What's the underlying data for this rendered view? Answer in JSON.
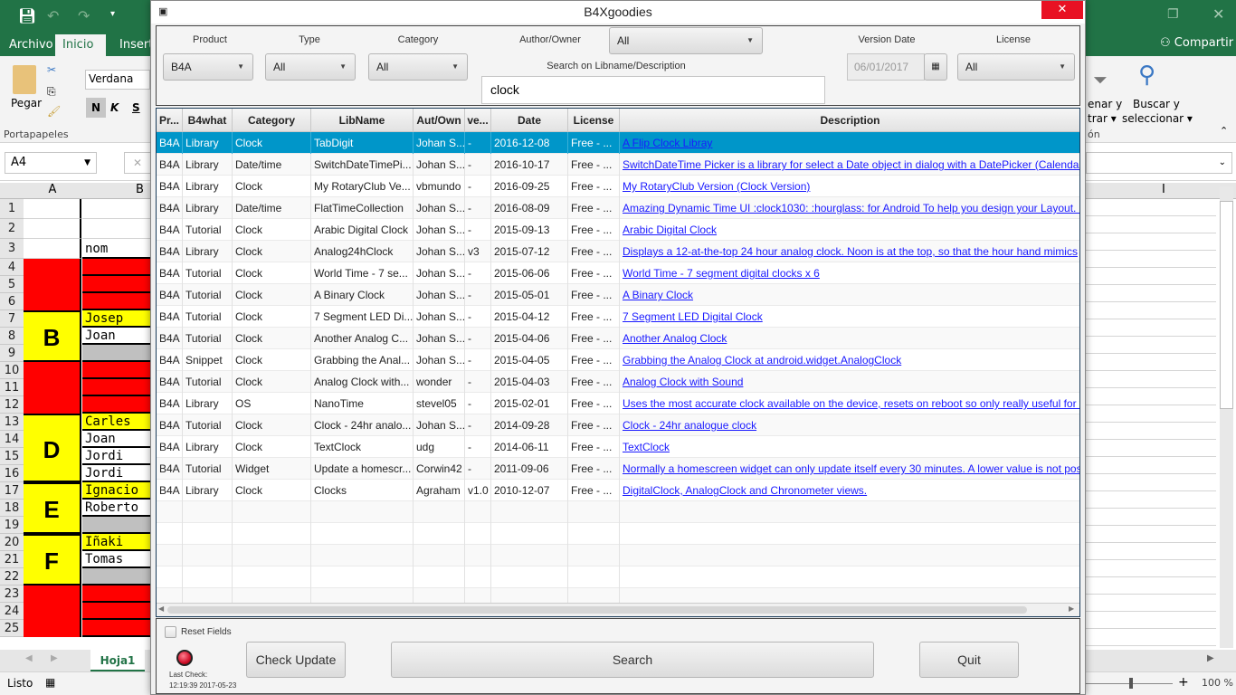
{
  "excel": {
    "tabs": [
      "Archivo",
      "Inicio",
      "Insertar"
    ],
    "share": "Compartir",
    "clipboard": {
      "paste": "Pegar",
      "group": "Portapapeles"
    },
    "font": "Verdana",
    "bold": "N",
    "italic": "K",
    "underline": "S",
    "find": "Buscar y",
    "find2": "seleccionar ▾",
    "sort": "enar y",
    "sort2": "trar ▾",
    "group_end": "ón",
    "namebox": "A4",
    "col_a": "A",
    "col_b": "B",
    "col_i": "I",
    "b3": "nom",
    "rows": [
      "1",
      "2",
      "3",
      "4",
      "5",
      "6",
      "7",
      "8",
      "9",
      "10",
      "11",
      "12",
      "13",
      "14",
      "15",
      "16",
      "17",
      "18",
      "19",
      "20",
      "21",
      "22",
      "23",
      "24",
      "25"
    ],
    "groups": [
      {
        "letter": "B"
      },
      {
        "letter": "D"
      },
      {
        "letter": "E"
      },
      {
        "letter": "F"
      }
    ],
    "names": {
      "7": "Josep",
      "8": "Joan",
      "13": "Carles",
      "14": "Joan",
      "15": "Jordi",
      "16": "Jordi",
      "17": "Ignacio",
      "18": "Roberto",
      "20": "Iñaki",
      "21": "Tomas"
    },
    "sheet": "Hoja1",
    "status": "Listo",
    "zoom": "100 %"
  },
  "app": {
    "title": "B4Xgoodies",
    "close": "✕",
    "filters": {
      "product": {
        "label": "Product",
        "value": "B4A"
      },
      "type": {
        "label": "Type",
        "value": "All"
      },
      "category": {
        "label": "Category",
        "value": "All"
      },
      "author": {
        "label": "Author/Owner",
        "value": "All"
      },
      "search": {
        "label": "Search on Libname/Description",
        "value": "clock"
      },
      "version_date": {
        "label": "Version Date",
        "value": "06/01/2017"
      },
      "license": {
        "label": "License",
        "value": "All"
      }
    },
    "columns": [
      "Pr...",
      "B4what",
      "Category",
      "LibName",
      "Aut/Own",
      "ve...",
      "Date",
      "License",
      "Description"
    ],
    "rows": [
      [
        "B4A",
        "Library",
        "Clock",
        "TabDigit",
        "Johan S...",
        "-",
        "2016-12-08",
        "Free - ...",
        "A Flip Clock Libray"
      ],
      [
        "B4A",
        "Library",
        "Date/time",
        "SwitchDateTimePi...",
        "Johan S...",
        "-",
        "2016-10-17",
        "Free - ...",
        "SwitchDateTime Picker is a library for select a Date object in dialog with a DatePicker (Calendar)"
      ],
      [
        "B4A",
        "Library",
        "Clock",
        "My RotaryClub Ve...",
        "vbmundo",
        "-",
        "2016-09-25",
        "Free - ...",
        "My RotaryClub Version (Clock Version)"
      ],
      [
        "B4A",
        "Library",
        "Date/time",
        "FlatTimeCollection",
        "Johan S...",
        "-",
        "2016-08-09",
        "Free - ...",
        "Amazing Dynamic Time UI :clock1030: :hourglass: for Android To help you design your Layout. it"
      ],
      [
        "B4A",
        "Tutorial",
        "Clock",
        "Arabic Digital Clock",
        "Johan S...",
        "-",
        "2015-09-13",
        "Free - ...",
        "Arabic Digital Clock"
      ],
      [
        "B4A",
        "Library",
        "Clock",
        "Analog24hClock",
        "Johan S...",
        "v3",
        "2015-07-12",
        "Free - ...",
        "Displays a 12-at-the-top 24 hour analog clock. Noon is at the top, so that the hour hand mimics"
      ],
      [
        "B4A",
        "Tutorial",
        "Clock",
        "World Time - 7 se...",
        "Johan S...",
        "-",
        "2015-06-06",
        "Free - ...",
        "World Time - 7 segment digital clocks x 6"
      ],
      [
        "B4A",
        "Tutorial",
        "Clock",
        "A Binary Clock",
        "Johan S...",
        "-",
        "2015-05-01",
        "Free - ...",
        "A Binary Clock"
      ],
      [
        "B4A",
        "Tutorial",
        "Clock",
        "7 Segment LED Di...",
        "Johan S...",
        "-",
        "2015-04-12",
        "Free - ...",
        "7 Segment LED Digital Clock"
      ],
      [
        "B4A",
        "Tutorial",
        "Clock",
        "Another Analog C...",
        "Johan S...",
        "-",
        "2015-04-06",
        "Free - ...",
        "Another Analog Clock"
      ],
      [
        "B4A",
        "Snippet",
        "Clock",
        "Grabbing the Anal...",
        "Johan S...",
        "-",
        "2015-04-05",
        "Free - ...",
        "Grabbing the Analog Clock at android.widget.AnalogClock"
      ],
      [
        "B4A",
        "Tutorial",
        "Clock",
        "Analog Clock with...",
        "wonder",
        "-",
        "2015-04-03",
        "Free - ...",
        "Analog Clock with Sound"
      ],
      [
        "B4A",
        "Library",
        "OS",
        "NanoTime",
        "stevel05",
        "-",
        "2015-02-01",
        "Free - ...",
        "Uses the most accurate clock available on the device, resets on reboot so only really useful for w"
      ],
      [
        "B4A",
        "Tutorial",
        "Clock",
        "Clock - 24hr analo...",
        "Johan S...",
        "-",
        "2014-09-28",
        "Free - ...",
        "Clock - 24hr analogue clock"
      ],
      [
        "B4A",
        "Library",
        "Clock",
        "TextClock",
        "udg",
        "-",
        "2014-06-11",
        "Free - ...",
        "TextClock"
      ],
      [
        "B4A",
        "Tutorial",
        "Widget",
        "Update a homescr...",
        "Corwin42",
        "-",
        "2011-09-06",
        "Free - ...",
        "Normally a homescreen widget can only update itself every 30 minutes. A lower value is not pos"
      ],
      [
        "B4A",
        "Library",
        "Clock",
        "Clocks",
        "Agraham",
        "v1.0",
        "2010-12-07",
        "Free - ...",
        "DigitalClock, AnalogClock and Chronometer views."
      ]
    ],
    "selected_row": 0,
    "bottom": {
      "reset": "Reset Fields",
      "last_check_label": "Last Check:",
      "last_check": "12:19:39 2017-05-23",
      "check_update": "Check Update",
      "search": "Search",
      "quit": "Quit"
    },
    "colors": {
      "selection": "#0096c9",
      "link": "#1a1aff",
      "status_led": "#d0102a",
      "excel_green": "#217346"
    }
  }
}
